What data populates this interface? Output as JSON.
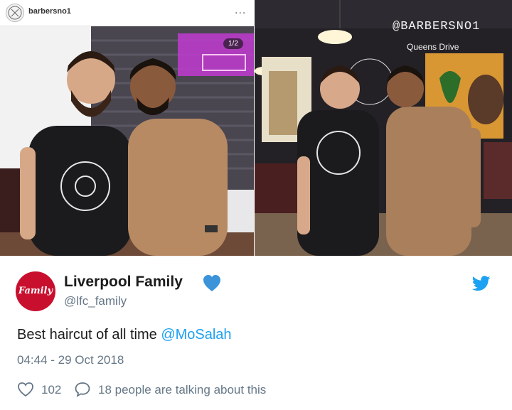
{
  "instagram": {
    "username": "barbersno1",
    "more_label": "...",
    "photo_counter": "1/2"
  },
  "right_photo": {
    "sign_main": "@BARBERSNO1",
    "sign_sub": "Queens Drive"
  },
  "tweet": {
    "display_name": "Liverpool Family",
    "handle": "@lfc_family",
    "avatar_text": "Family",
    "text_prefix": "Best haircut of all time ",
    "mention": "@MoSalah",
    "timestamp": "04:44 - 29 Oct 2018",
    "likes": "102",
    "talk": "18 people are talking about this"
  },
  "colors": {
    "link": "#1da1f2",
    "avatar_red": "#c8102e",
    "muted": "#657786"
  }
}
